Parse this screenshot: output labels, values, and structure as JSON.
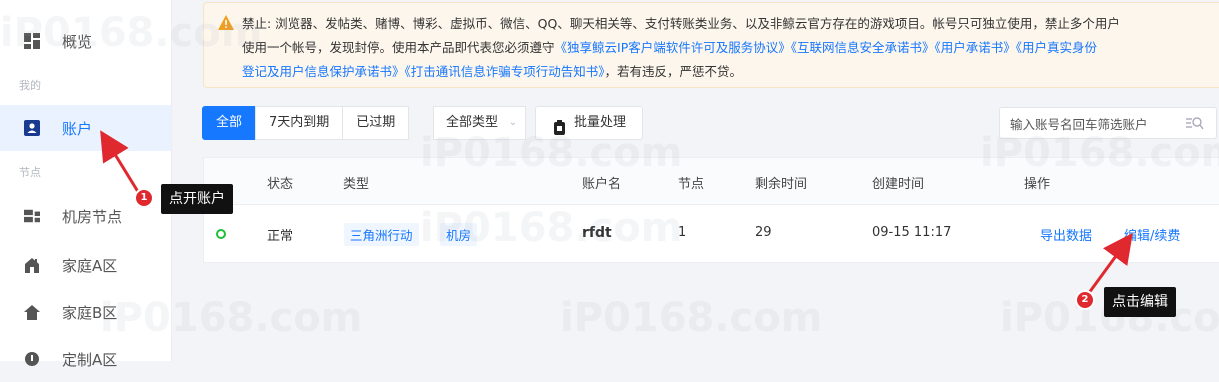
{
  "sidebar": {
    "items": [
      {
        "label": "概览",
        "icon": "dashboard-icon"
      },
      {
        "label": "账户",
        "icon": "account-icon",
        "active": true
      },
      {
        "label": "机房节点",
        "icon": "server-room-icon"
      },
      {
        "label": "家庭A区",
        "icon": "home-building-icon"
      },
      {
        "label": "家庭B区",
        "icon": "house-icon"
      },
      {
        "label": "定制A区",
        "icon": "custom-icon"
      }
    ],
    "section_mine": "我的",
    "section_nodes": "节点"
  },
  "notice": {
    "icon": "warning-icon",
    "line1": "禁止: 浏览器、发帖类、赌博、博彩、虚拟币、微信、QQ、聊天相关等、支付转账类业务、以及非鲸云官方存在的游戏项目。帐号只可独立使用，禁止多个用户",
    "line2_prefix": "使用一个帐号，发现封停。使用本产品即代表您必须遵守",
    "link1": "《独享鲸云IP客户端软件许可及服务协议》",
    "link2": "《互联网信息安全承诺书》",
    "link3": "《用户承诺书》",
    "link4": "《用户真实身份",
    "link4_cont": "登记及用户信息保护承诺书》",
    "link5": "《打击通讯信息诈骗专项行动告知书》",
    "line3_suffix": "，若有违反，严惩不贷。"
  },
  "toolbar": {
    "tabs": [
      "全部",
      "7天内到期",
      "已过期"
    ],
    "type_select": "全部类型",
    "batch_label": "批量处理",
    "search_placeholder": "输入账号名回车筛选账户"
  },
  "table": {
    "headers": [
      "状态",
      "类型",
      "账户名",
      "节点",
      "剩余时间",
      "创建时间",
      "操作"
    ],
    "rows": [
      {
        "status": "正常",
        "type_game": "三角洲行动",
        "type_node": "机房",
        "account": "rfdt",
        "nodes": "1",
        "remaining": "29",
        "created": "09-15 11:17",
        "action_export": "导出数据",
        "action_edit": "编辑/续费"
      }
    ]
  },
  "annotations": {
    "step1_num": "1",
    "step1_text": "点开账户",
    "step2_num": "2",
    "step2_text": "点击编辑",
    "arrow_color": "#e0282f"
  },
  "watermark": "iP0168.com",
  "colors": {
    "accent": "#1677ff",
    "status_ok": "#1fbf3a",
    "badge": "#e0282f"
  }
}
